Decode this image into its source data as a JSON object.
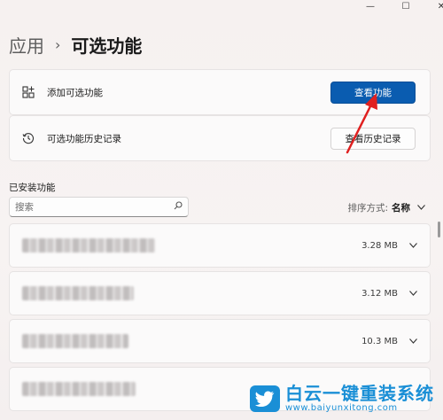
{
  "window": {
    "minimize_icon": "minimize-icon",
    "maximize_icon": "maximize-icon",
    "close_icon": "close-icon"
  },
  "breadcrumb": {
    "root": "应用",
    "separator": "›",
    "current": "可选功能"
  },
  "add_feature": {
    "label": "添加可选功能",
    "button": "查看功能",
    "icon": "add-apps-icon"
  },
  "history": {
    "label": "可选功能历史记录",
    "button": "查看历史记录",
    "icon": "history-icon"
  },
  "installed": {
    "title": "已安装功能",
    "search_placeholder": "搜索",
    "sort_label": "排序方式:",
    "sort_value": "名称",
    "items": [
      {
        "size": "3.28 MB"
      },
      {
        "size": "3.12 MB"
      },
      {
        "size": "10.3 MB"
      },
      {
        "size": ""
      }
    ]
  },
  "watermark": {
    "text_cn": "白云一键重装系统",
    "text_en": "www.baiyunxitong.com"
  },
  "colors": {
    "accent": "#0a5cb0",
    "annotation_arrow": "#e02020",
    "watermark": "#1a8fd6"
  }
}
